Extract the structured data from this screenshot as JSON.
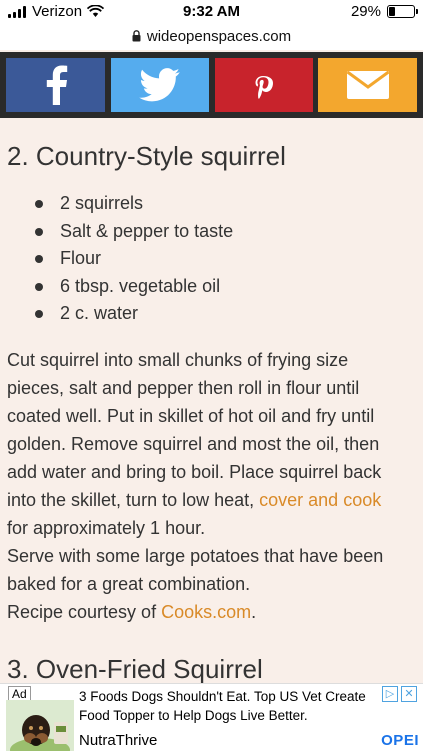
{
  "status_bar": {
    "carrier": "Verizon",
    "time": "9:32 AM",
    "battery_percent": "29%",
    "battery_level": 0.29,
    "icons": [
      "signal-icon",
      "wifi-icon",
      "battery-icon"
    ]
  },
  "browser": {
    "url": "wideopenspaces.com",
    "lock_icon": "lock-icon"
  },
  "share_buttons": [
    {
      "name": "facebook",
      "icon": "facebook-icon",
      "color": "#3b5998"
    },
    {
      "name": "twitter",
      "icon": "twitter-icon",
      "color": "#55acee"
    },
    {
      "name": "pinterest",
      "icon": "pinterest-icon",
      "color": "#c8232c"
    },
    {
      "name": "email",
      "icon": "email-icon",
      "color": "#f3a72e"
    }
  ],
  "article": {
    "section2_title": "2. Country-Style squirrel",
    "ingredients": [
      "2 squirrels",
      "Salt & pepper to taste",
      "Flour",
      "6 tbsp. vegetable oil",
      "2 c. water"
    ],
    "lines": [
      "Cut squirrel into small chunks of frying size",
      "pieces, salt and pepper then roll in flour until",
      "coated well. Put in skillet of hot oil and fry until",
      "golden. Remove squirrel and most the oil, then",
      "add water and bring to boil. Place squirrel back"
    ],
    "line6_prefix": "into the skillet, turn to low heat, ",
    "line6_link": "cover and cook",
    "line7": "for approximately 1 hour.",
    "line8": "Serve with some large potatoes that have been",
    "line9": "baked for a great combination.",
    "credit_prefix": "Recipe courtesy of ",
    "credit_link": "Cooks.com",
    "credit_suffix": ".",
    "section3_title": "3. Oven-Fried Squirrel",
    "link_color": "#d98a28"
  },
  "ad": {
    "badge": "Ad",
    "headline_line1": "3 Foods Dogs Shouldn't Eat. Top US Vet Create",
    "headline_line2": "Food Topper to Help Dogs Live Better.",
    "brand": "NutraThrive",
    "cta": "OPEI"
  }
}
